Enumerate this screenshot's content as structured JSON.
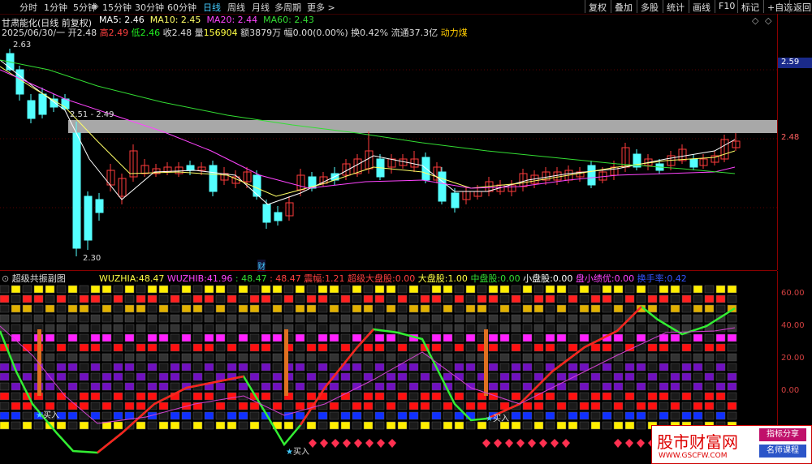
{
  "toolbar": {
    "stock": "甘肃能化(日线 前复权)",
    "periods": [
      "分时",
      "1分钟",
      "5分钟",
      "15分钟",
      "30分钟",
      "60分钟",
      "日线",
      "周线",
      "月线",
      "多周期",
      "更多 >"
    ],
    "active_period": "日线",
    "right_buttons": [
      "复权",
      "叠加",
      "多股",
      "统计",
      "画线",
      "F10",
      "标记",
      "+自选",
      "返回"
    ]
  },
  "ma_legend": {
    "ma5": "MA5: 2.46",
    "ma10": "MA10: 2.45",
    "ma20": "MA20: 2.44",
    "ma60": "MA60: 2.43"
  },
  "quote": {
    "date": "2025/06/30/一",
    "open_label": "开",
    "open": "2.48",
    "high_label": "高",
    "high": "2.49",
    "low_label": "低",
    "low": "2.46",
    "close_label": "收",
    "close": "2.48",
    "vol_label": "量",
    "vol": "156904",
    "amt_label": "额",
    "amt": "3879万",
    "chg_label": "幅",
    "chg": "0.00(0.00%)",
    "turn_label": "换",
    "turn": "0.42%",
    "float_label": "流通",
    "float": "37.3亿",
    "sector": "动力煤"
  },
  "price_annotations": {
    "high_mark": "2.63",
    "range_mark": "2.51 - 2.49",
    "low_mark": "2.30",
    "cai": "财"
  },
  "price_axis": {
    "tag_current": "2.59",
    "tag_last": "2.48"
  },
  "indicator": {
    "name": "超级共振副图",
    "wuzhia_label": "WUZHIA:",
    "wuzhia": "48.47",
    "wuzhib_label": "WUZHIB:",
    "wuzhib": "41.96",
    "v3": ": 48.47",
    "v4": ": 48.47",
    "zhenfu_label": "震幅:",
    "zhenfu": "1.21",
    "dapan_label": "超级大盘股:",
    "dapan": "0.00",
    "big_label": "大盘股:",
    "big": "1.00",
    "mid_label": "中盘股:",
    "mid": "0.00",
    "small_label": "小盘股:",
    "small": "0.00",
    "smallopt_label": "盘小绩优:",
    "smallopt": "0.00",
    "turnover_label": "换手率:",
    "turnover": "0.42",
    "buy": "买入",
    "axis": [
      "60.00",
      "40.00",
      "20.00",
      "0.00"
    ]
  },
  "watermark": {
    "title": "股市财富网",
    "url": "WWW.GSCFW.COM",
    "btn1": "指标分享",
    "btn2": "名师课程"
  },
  "colors": {
    "up": "#ff3b3b",
    "down": "#54ffff",
    "ma5": "#ffffff",
    "ma10": "#ffff66",
    "ma20": "#ff44ff",
    "ma60": "#33dd33"
  }
}
